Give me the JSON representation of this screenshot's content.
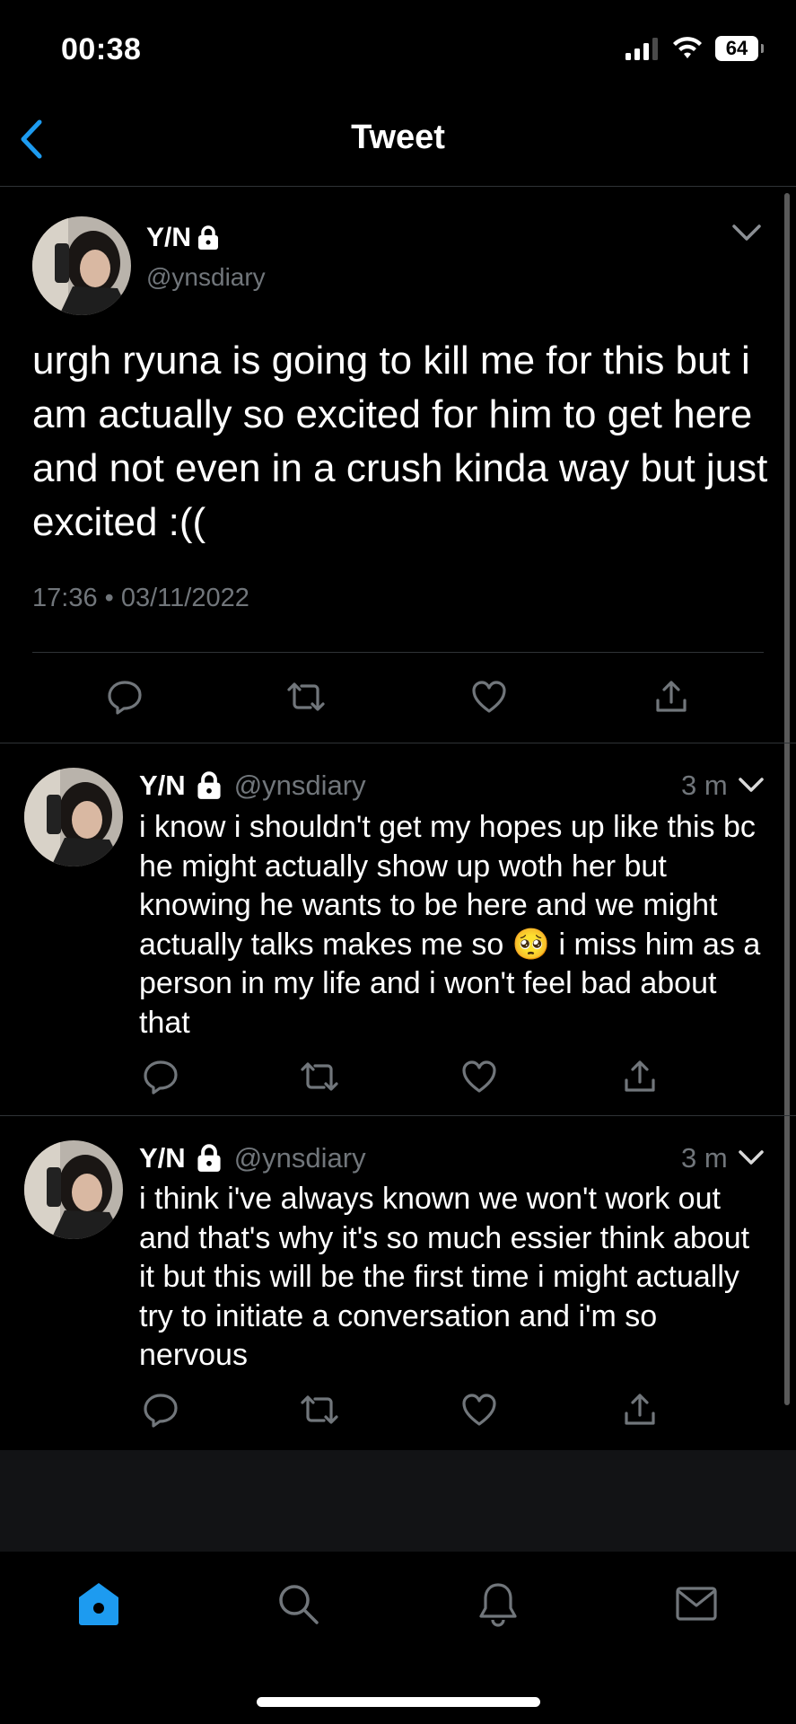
{
  "status_bar": {
    "time": "00:38",
    "battery": "64"
  },
  "nav": {
    "title": "Tweet"
  },
  "main_tweet": {
    "name": "Y/N",
    "handle": "@ynsdiary",
    "text": "urgh ryuna is going to kill me for this but i am actually so excited for him to get here and not even in a crush kinda way but just excited :((",
    "timestamp": "17:36 • 03/11/2022"
  },
  "replies": [
    {
      "name": "Y/N",
      "handle": "@ynsdiary",
      "time": "3 m",
      "text": "i know i shouldn't get my hopes up like this bc he might actually show up woth her but knowing he wants to be here and we might actually talks makes me so 🥺 i miss him as a person in my life and i won't feel bad about that"
    },
    {
      "name": "Y/N",
      "handle": "@ynsdiary",
      "time": "3 m",
      "text": "i think i've always known we won't work out and that's why it's so much essier think about it but this will be the first time i might actually try to initiate a conversation and i'm so nervous"
    }
  ],
  "tabbar": {
    "items": [
      "home-icon",
      "search-icon",
      "notifications-icon",
      "messages-icon"
    ],
    "active_color": "#1d9bf0"
  },
  "colors": {
    "accent": "#1d9bf0",
    "secondary_text": "#71767b",
    "divider": "#2f3336"
  }
}
